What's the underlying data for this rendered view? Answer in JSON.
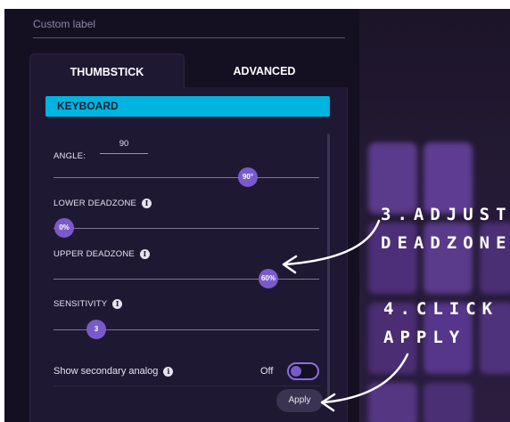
{
  "custom_label": {
    "placeholder": "Custom label"
  },
  "tabs": [
    {
      "label": "THUMBSTICK",
      "active": true
    },
    {
      "label": "ADVANCED",
      "active": false
    }
  ],
  "section": {
    "title": "KEYBOARD"
  },
  "angle": {
    "label": "ANGLE:",
    "value": "90",
    "slider_value": "90°",
    "level": 0.8
  },
  "lower_deadzone": {
    "label": "LOWER DEADZONE",
    "slider_value": "0%",
    "level": 0.0
  },
  "upper_deadzone": {
    "label": "UPPER DEADZONE",
    "slider_value": "60%",
    "level": 0.8
  },
  "sensitivity": {
    "label": "SENSITIVITY",
    "slider_value": "3",
    "level": 0.15
  },
  "secondary_analog": {
    "label": "Show secondary analog",
    "state": "Off"
  },
  "apply_button": {
    "label": "Apply"
  },
  "annotations": {
    "step3_line1": "3.ADJUST",
    "step3_line2": "DEADZONE",
    "step4_line1": "4.CLICK",
    "step4_line2": "APPLY"
  },
  "colors": {
    "accent": "#00b4e0",
    "thumb": "#7a5acb",
    "panel": "#1f1833"
  }
}
